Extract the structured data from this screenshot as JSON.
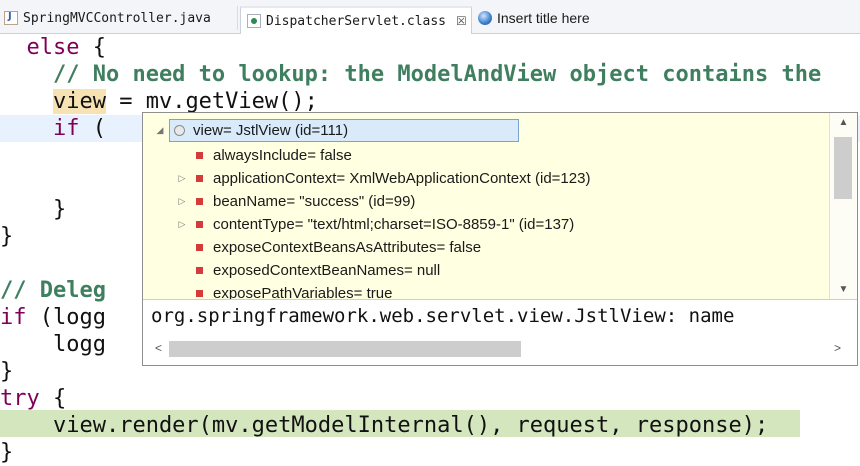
{
  "tabs": [
    {
      "label": "SpringMVCController.java",
      "icon": "java-file-icon",
      "active": false
    },
    {
      "label": "DispatcherServlet.class",
      "icon": "class-file-icon",
      "active": true,
      "close": "☒"
    },
    {
      "label": "Insert title here",
      "icon": "globe-icon",
      "active": false
    }
  ],
  "code": {
    "l1_kw": "else",
    "l1_rest": " {",
    "l2": "    // No need to lookup: the ModelAndView object contains the",
    "l3_var": "view",
    "l3_rest": " = mv.getView();",
    "l4_kw": "if",
    "l4_rest": " (",
    "l5": "    }",
    "l6": "}",
    "l7": "// Deleg",
    "l8_kw": "if",
    "l8_rest": " (logg",
    "l9": "    logg",
    "l10": "}",
    "l11_kw": "try",
    "l11_rest": " {",
    "l12": "    view.render(mv.getModelInternal(), request, response);",
    "l13": "}"
  },
  "popup": {
    "root": "view= JstlView  (id=111)",
    "fields": [
      {
        "text": "alwaysInclude= false",
        "expandable": false
      },
      {
        "text": "applicationContext= XmlWebApplicationContext  (id=123)",
        "expandable": true
      },
      {
        "text": "beanName= \"success\" (id=99)",
        "expandable": true
      },
      {
        "text": "contentType= \"text/html;charset=ISO-8859-1\" (id=137)",
        "expandable": true
      },
      {
        "text": "exposeContextBeansAsAttributes= false",
        "expandable": false
      },
      {
        "text": "exposedContextBeanNames= null",
        "expandable": false
      },
      {
        "text": "exposePathVariables= true",
        "expandable": false
      }
    ],
    "detail": "org.springframework.web.servlet.view.JstlView: name",
    "expand_glyph": "▷",
    "collapse_glyph": "◢",
    "scroll_up": "▲",
    "scroll_down": "▼",
    "scroll_left": "<",
    "scroll_right": ">"
  },
  "colors": {
    "keyword": "#7f0055",
    "comment": "#3f7f5f",
    "popup_bg": "#ffffe1",
    "current_line": "#e8f2fe",
    "debug_line": "#d4e6bd"
  }
}
